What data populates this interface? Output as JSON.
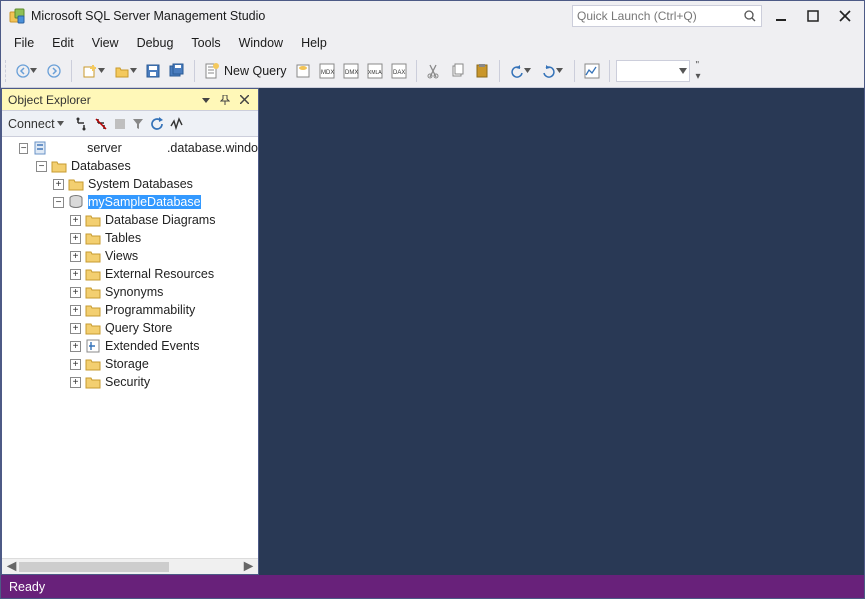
{
  "title": "Microsoft SQL Server Management Studio",
  "quickLaunch": {
    "placeholder": "Quick Launch (Ctrl+Q)"
  },
  "menu": {
    "file": "File",
    "edit": "Edit",
    "view": "View",
    "debug": "Debug",
    "tools": "Tools",
    "window": "Window",
    "help": "Help"
  },
  "toolbar": {
    "newQuery": "New Query"
  },
  "explorer": {
    "title": "Object Explorer",
    "connect": "Connect",
    "server": "server",
    "serverSuffix": ".database.windo",
    "databases": "Databases",
    "systemDatabases": "System Databases",
    "selected": "mySampleDatabase",
    "items": [
      "Database Diagrams",
      "Tables",
      "Views",
      "External Resources",
      "Synonyms",
      "Programmability",
      "Query Store",
      "Extended Events",
      "Storage",
      "Security"
    ]
  },
  "status": {
    "ready": "Ready"
  }
}
